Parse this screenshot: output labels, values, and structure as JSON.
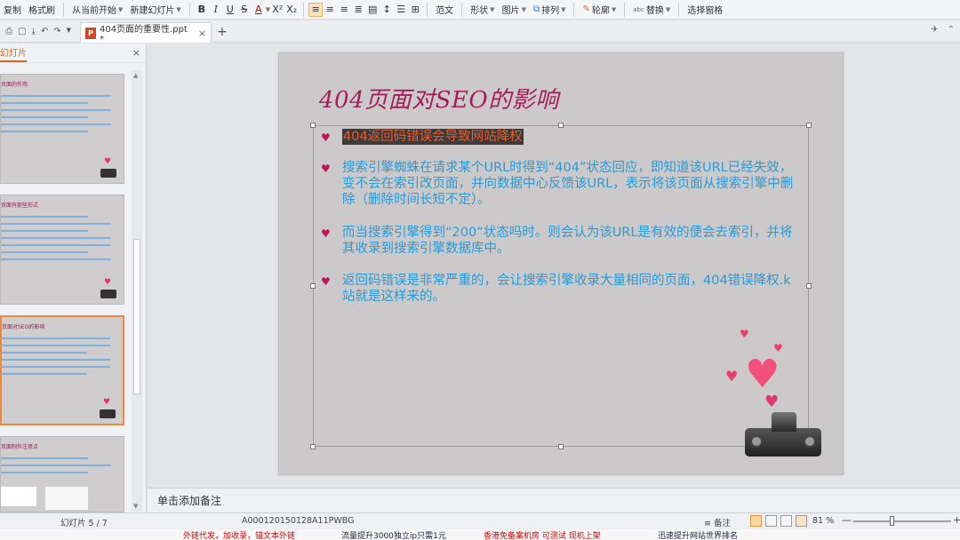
{
  "ribbon": {
    "copy": "复制",
    "format_painter": "格式刷",
    "from_current": "从当前开始",
    "new_slide": "新建幻灯片",
    "bold": "B",
    "italic": "I",
    "underline": "U",
    "strike": "S",
    "font_color": "A",
    "superscript": "X²",
    "subscript": "X₂",
    "template": "范文",
    "shape": "形状",
    "picture": "图片",
    "arrange": "排列",
    "outline": "轮廓",
    "replace": "替换",
    "select_pane": "选择窗格"
  },
  "tabbar": {
    "doc_title": "404页面的重要性.ppt *",
    "ppt_icon_label": "P",
    "close": "×",
    "add": "+"
  },
  "thumbpane": {
    "header": "幻灯片",
    "close": "×",
    "thumbs": [
      {
        "title": "页面的作用"
      },
      {
        "title": "页面有那些形式"
      },
      {
        "title": "页面对SEO的影响"
      },
      {
        "title": "页面制作注意点"
      }
    ]
  },
  "slide": {
    "title": "404页面对SEO的影响",
    "bullets": [
      "404返回码错误会导致网站降权",
      "搜索引擎蜘蛛在请求某个URL时得到“404”状态回应，即知道该URL已经失效，变不会在索引改页面，并向数据中心反馈该URL，表示将该页面从搜索引擎中删除（删除时间长短不定）。",
      "而当搜索引擎得到“200”状态吗时。则会认为该URL是有效的便会去索引，并将其收录到搜索引擎数据库中。",
      "返回码错误是非常严重的，会让搜索引擎收录大量相同的页面，404错误降权.k站就是这样来的。"
    ],
    "bullet_glyph": "♥"
  },
  "notes": {
    "placeholder": "单击添加备注"
  },
  "status": {
    "slide_counter": "幻灯片 5 / 7",
    "template_id": "A000120150128A11PWBG",
    "notes_label": "备注",
    "zoom": "81 %",
    "minus": "—",
    "plus": "+"
  },
  "ads": [
    "外链代发，加收录，锚文本外链",
    "流量提升3000独立ip只需1元",
    "香港免备案机房 可测试 现机上架",
    "迅速提升网站世界排名"
  ],
  "colors": {
    "title": "#a61c5a",
    "body_text": "#2b9ad8",
    "bullet": "#c1145a",
    "highlight_bg": "#3b3b3b",
    "highlight_text": "#e75a2a",
    "accent_orange": "#f0883c"
  }
}
